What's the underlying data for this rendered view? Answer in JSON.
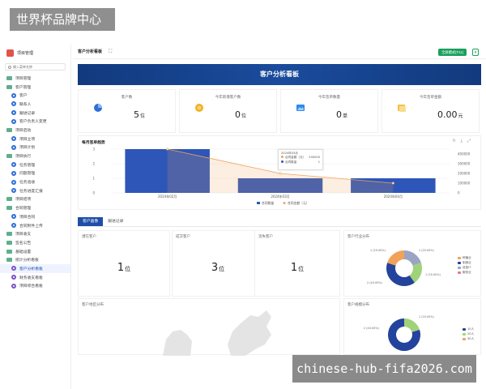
{
  "watermark_top": "世界杯品牌中心",
  "watermark_bottom": "chinese-hub-fifa2026.com",
  "sidebar": {
    "app_name": "项目管理",
    "search_placeholder": "输入菜单名称",
    "items": [
      {
        "label": "项目管理",
        "kind": "group"
      },
      {
        "label": "客户管理",
        "kind": "group"
      },
      {
        "label": "客户",
        "kind": "child"
      },
      {
        "label": "联系人",
        "kind": "child"
      },
      {
        "label": "跟进记录",
        "kind": "child"
      },
      {
        "label": "客户负责人变更",
        "kind": "child"
      },
      {
        "label": "项目启动",
        "kind": "group"
      },
      {
        "label": "项目立项",
        "kind": "child"
      },
      {
        "label": "项目计划",
        "kind": "child"
      },
      {
        "label": "项目执行",
        "kind": "group"
      },
      {
        "label": "任务管理",
        "kind": "child"
      },
      {
        "label": "问题管理",
        "kind": "child"
      },
      {
        "label": "任务验收",
        "kind": "child"
      },
      {
        "label": "任务进度汇报",
        "kind": "child"
      },
      {
        "label": "项目结项",
        "kind": "group"
      },
      {
        "label": "合同管理",
        "kind": "group"
      },
      {
        "label": "项目合同",
        "kind": "child"
      },
      {
        "label": "合同附件上传",
        "kind": "child"
      },
      {
        "label": "项目收支",
        "kind": "group"
      },
      {
        "label": "签名公告",
        "kind": "group"
      },
      {
        "label": "基础设置",
        "kind": "group"
      },
      {
        "label": "统计分析看板",
        "kind": "group"
      },
      {
        "label": "客户分析看板",
        "kind": "child",
        "active": true
      },
      {
        "label": "财务收支看板",
        "kind": "child"
      },
      {
        "label": "项目综合看板",
        "kind": "child"
      }
    ]
  },
  "topbar": {
    "tab_label": "客户分析看板",
    "expand_icon": "expand-icon",
    "enter_button": "全屏模式(F11)"
  },
  "banner_title": "客户分析看板",
  "stats": [
    {
      "label": "客户数",
      "value": "5",
      "unit": "位",
      "icon": "user-pie-icon",
      "color": "#2f6fd6"
    },
    {
      "label": "今年新增客户数",
      "value": "0",
      "unit": "位",
      "icon": "coin-icon",
      "color": "#f2b01e"
    },
    {
      "label": "今年签单数量",
      "value": "0",
      "unit": "单",
      "icon": "image-icon",
      "color": "#2f8be6"
    },
    {
      "label": "今年签单金额",
      "value": "0.00",
      "unit": "元",
      "icon": "folder-icon",
      "color": "#f5c242"
    }
  ],
  "monthly_chart": {
    "title": "每月签单趋势",
    "tool_icons": [
      "refresh-icon",
      "download-icon",
      "fullscreen-icon"
    ],
    "tooltip": {
      "title": "2024年03月",
      "rows": [
        {
          "name": "合同金额（元）",
          "value": "200000"
        },
        {
          "name": "合同数量",
          "value": "1"
        }
      ]
    }
  },
  "chart_data": {
    "type": "bar",
    "title": "每月签单趋势",
    "categories": [
      "2024年02月",
      "2024年03月",
      "2024年04月"
    ],
    "series": [
      {
        "name": "合同数量",
        "type": "bar",
        "axis": "left",
        "values": [
          3,
          1,
          1
        ]
      },
      {
        "name": "合同金额（元）",
        "type": "line",
        "axis": "right",
        "values": [
          450000,
          200000,
          100000
        ]
      }
    ],
    "y_left": {
      "ticks": [
        0,
        1,
        2,
        3
      ]
    },
    "y_right": {
      "ticks": [
        0,
        100000,
        200000,
        300000,
        400000
      ]
    },
    "legend": "bottom",
    "colors": {
      "bar": "#2d56b8",
      "line": "#f0a25a"
    }
  },
  "tabs": [
    {
      "label": "客户画像",
      "active": true
    },
    {
      "label": "跟进记录",
      "active": false
    }
  ],
  "mini_cards": [
    {
      "label": "潜在客户",
      "value": "1",
      "unit": "位"
    },
    {
      "label": "成交客户",
      "value": "3",
      "unit": "位"
    },
    {
      "label": "流失客户",
      "value": "1",
      "unit": "位"
    }
  ],
  "pie1": {
    "title": "客户行业分布",
    "slices": [
      {
        "label": "1 (20.00%)",
        "color": "#f0a25a"
      },
      {
        "label": "1 (20.00%)",
        "color": "#9aa5c4"
      },
      {
        "label": "1 (20.00%)",
        "color": "#a0d27a"
      },
      {
        "label": "2 (40.00%)",
        "color": "#23439c"
      }
    ],
    "legend": [
      {
        "label": "种植业",
        "color": "#f0a25a"
      },
      {
        "label": "制造业",
        "color": "#23439c"
      },
      {
        "label": "信息IT",
        "color": "#9aa5c4"
      },
      {
        "label": "服务业",
        "color": "#e07b8a"
      }
    ]
  },
  "pie2": {
    "title": "客户规模分布",
    "slices": [
      {
        "label": "2 (40.00%)",
        "color": "#23439c"
      },
      {
        "label": "1 (20.00%)",
        "color": "#a0d27a"
      }
    ],
    "legend": [
      {
        "label": "10人",
        "color": "#23439c"
      },
      {
        "label": "20人",
        "color": "#a0d27a"
      },
      {
        "label": "30人",
        "color": "#f0a25a"
      }
    ]
  },
  "map_card": {
    "title": "客户地区分布"
  }
}
